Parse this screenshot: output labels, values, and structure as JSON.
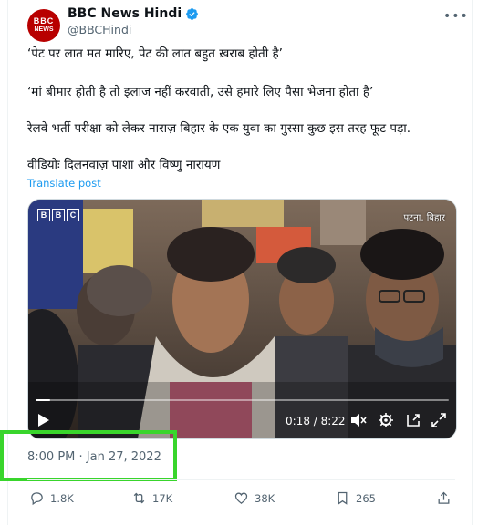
{
  "account": {
    "display_name": "BBC News Hindi",
    "handle": "@BBCHindi",
    "avatar_top": "BBC",
    "avatar_bottom": "NEWS",
    "verified": true,
    "more_glyph": "•••"
  },
  "post": {
    "line1": "‘पेट पर लात मत मारिए, पेट की लात बहुत ख़राब होती है’",
    "line2": "‘मां बीमार होती है तो इलाज नहीं करवाती, उसे हमारे लिए पैसा भेजना होता है’",
    "line3": "रेलवे भर्ती परीक्षा को लेकर नाराज़ बिहार के एक युवा का गुस्सा कुछ इस तरह फूट पड़ा.",
    "line4": "वीडियोः दिलनवाज़ पाशा और विष्णु नारायण",
    "translate_label": "Translate post"
  },
  "video": {
    "watermark": [
      "B",
      "B",
      "C"
    ],
    "location": "पटना, बिहार",
    "time_readout": "0:18 / 8:22",
    "progress_fraction": 0.036
  },
  "timestamp": "8:00 PM · Jan 27, 2022",
  "actions": {
    "replies": "1.8K",
    "reposts": "17K",
    "likes": "38K",
    "bookmarks": "265"
  },
  "colors": {
    "accent": "#1d9bf0",
    "highlight_border": "#39d52c",
    "brand": "#b80000"
  }
}
